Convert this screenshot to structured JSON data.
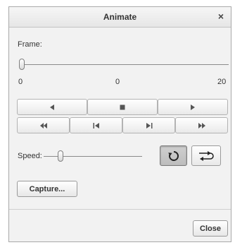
{
  "dialog": {
    "title": "Animate",
    "close_glyph": "×"
  },
  "frame": {
    "label": "Frame:",
    "min_label": "0",
    "current_label": "0",
    "max_label": "20",
    "value": 0
  },
  "playback": {
    "row1": [
      {
        "icon": "step-back-icon"
      },
      {
        "icon": "stop-icon"
      },
      {
        "icon": "play-icon"
      }
    ],
    "row2": [
      {
        "icon": "rewind-icon"
      },
      {
        "icon": "first-frame-icon"
      },
      {
        "icon": "last-frame-icon"
      },
      {
        "icon": "fast-forward-icon"
      }
    ]
  },
  "speed": {
    "label": "Speed:",
    "level": 0.15
  },
  "loop_modes": [
    {
      "icon": "loop-icon",
      "selected": true
    },
    {
      "icon": "oscillate-icon",
      "selected": false
    }
  ],
  "capture_label": "Capture...",
  "close_label": "Close"
}
